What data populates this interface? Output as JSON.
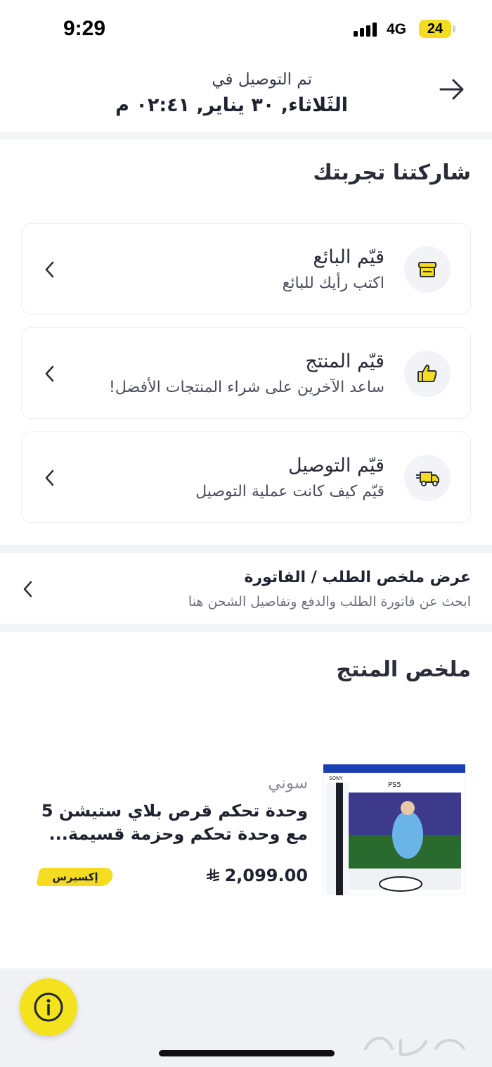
{
  "status_bar": {
    "time": "9:29",
    "network": "4G",
    "battery": "24"
  },
  "header": {
    "delivered_label": "تم التوصيل في",
    "delivered_date": "الثَلاثاء, ٣٠ يناير, ٠٢:٤١ م"
  },
  "share": {
    "title": "شاركتنا تجربتك",
    "cards": [
      {
        "title": "قيّم البائع",
        "subtitle": "اكتب رأيك للبائع",
        "icon": "store-icon"
      },
      {
        "title": "قيّم المنتج",
        "subtitle": "ساعد الآخرين على شراء المنتجات الأفضل!",
        "icon": "thumbs-up-icon"
      },
      {
        "title": "قيّم التوصيل",
        "subtitle": "قيّم كيف كانت عملية التوصيل",
        "icon": "delivery-truck-icon"
      }
    ]
  },
  "invoice": {
    "title": "عرض ملخص الطلب / الفاتورة",
    "subtitle": "ابحث عن فاتورة الطلب والدفع وتفاصيل الشحن هنا"
  },
  "product_summary": {
    "title": "ملخص المنتج",
    "brand": "سوني",
    "name": "وحدة تحكم قرص بلاي ستيشن 5 مع وحدة تحكم وحزمة قسيمة...",
    "price": "2,099.00",
    "currency_icon": "riyal-icon",
    "badge": "إكسبرس"
  },
  "colors": {
    "accent": "#f4dd21",
    "text": "#1f2330",
    "divider": "#f3f4f7"
  }
}
